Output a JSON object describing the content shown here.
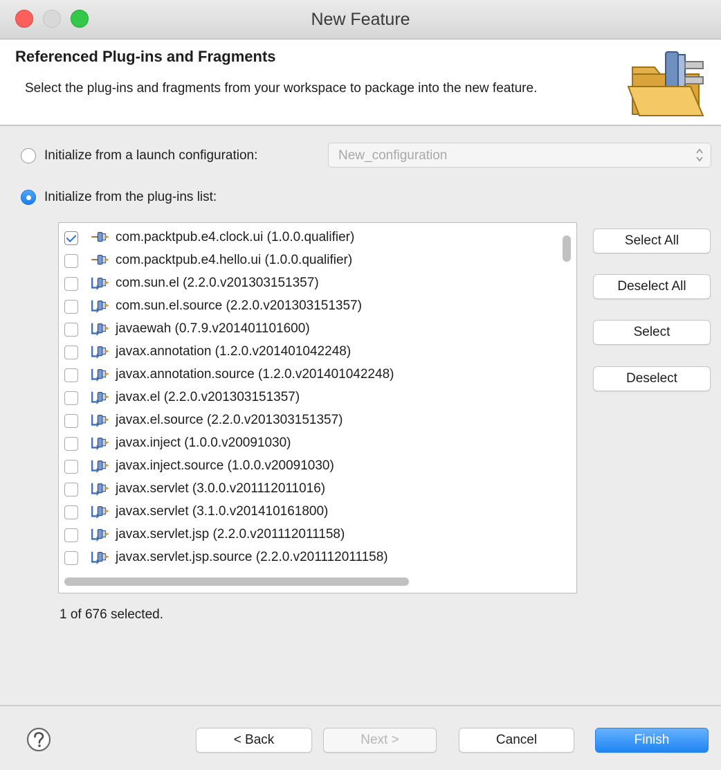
{
  "window": {
    "title": "New Feature"
  },
  "header": {
    "title": "Referenced Plug-ins and Fragments",
    "description": "Select the plug-ins and fragments from your workspace to package into the new feature."
  },
  "options": {
    "launch_config_label": "Initialize from a launch configuration:",
    "launch_config_value": "New_configuration",
    "plugins_list_label": "Initialize from the plug-ins list:",
    "selected_option": "plugins_list"
  },
  "plugins": [
    {
      "label": "com.packtpub.e4.clock.ui (1.0.0.qualifier)",
      "checked": true,
      "kind": "workspace"
    },
    {
      "label": "com.packtpub.e4.hello.ui (1.0.0.qualifier)",
      "checked": false,
      "kind": "workspace"
    },
    {
      "label": "com.sun.el (2.2.0.v201303151357)",
      "checked": false,
      "kind": "external"
    },
    {
      "label": "com.sun.el.source (2.2.0.v201303151357)",
      "checked": false,
      "kind": "external"
    },
    {
      "label": "javaewah (0.7.9.v201401101600)",
      "checked": false,
      "kind": "external"
    },
    {
      "label": "javax.annotation (1.2.0.v201401042248)",
      "checked": false,
      "kind": "external"
    },
    {
      "label": "javax.annotation.source (1.2.0.v201401042248)",
      "checked": false,
      "kind": "external"
    },
    {
      "label": "javax.el (2.2.0.v201303151357)",
      "checked": false,
      "kind": "external"
    },
    {
      "label": "javax.el.source (2.2.0.v201303151357)",
      "checked": false,
      "kind": "external"
    },
    {
      "label": "javax.inject (1.0.0.v20091030)",
      "checked": false,
      "kind": "external"
    },
    {
      "label": "javax.inject.source (1.0.0.v20091030)",
      "checked": false,
      "kind": "external"
    },
    {
      "label": "javax.servlet (3.0.0.v201112011016)",
      "checked": false,
      "kind": "external"
    },
    {
      "label": "javax.servlet (3.1.0.v201410161800)",
      "checked": false,
      "kind": "external"
    },
    {
      "label": "javax.servlet.jsp (2.2.0.v201112011158)",
      "checked": false,
      "kind": "external"
    },
    {
      "label": "javax.servlet.jsp.source (2.2.0.v201112011158)",
      "checked": false,
      "kind": "external"
    }
  ],
  "side_buttons": {
    "select_all": "Select All",
    "deselect_all": "Deselect All",
    "select": "Select",
    "deselect": "Deselect"
  },
  "status": "1 of 676 selected.",
  "footer": {
    "back": "< Back",
    "next": "Next >",
    "cancel": "Cancel",
    "finish": "Finish"
  },
  "icons": {
    "help": "help-icon",
    "header": "folder-plugin-icon",
    "workspace_plugin": "workspace-plugin-icon",
    "external_plugin": "external-plugin-icon"
  },
  "colors": {
    "accent": "#1f85f2"
  }
}
